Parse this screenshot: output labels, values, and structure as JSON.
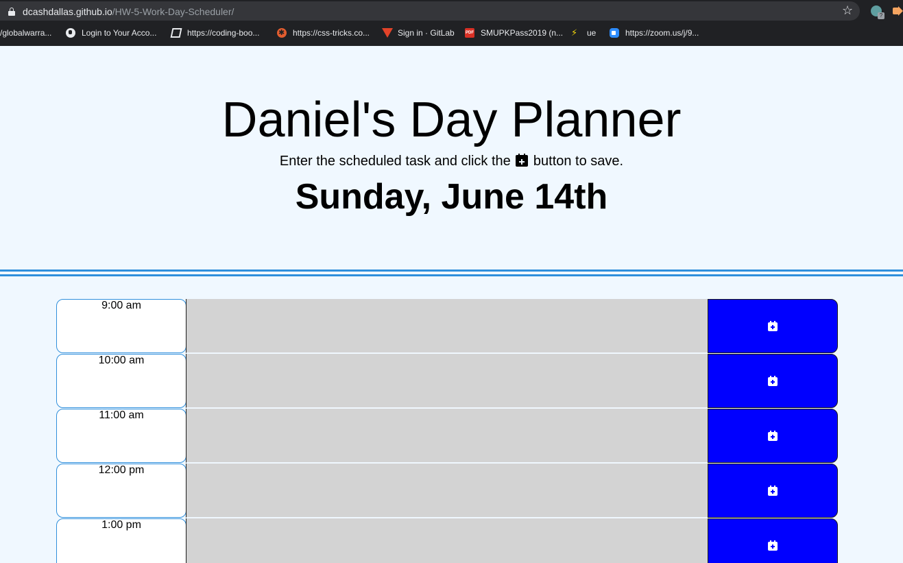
{
  "browser": {
    "url_host": "dcashdallas.github.io",
    "url_path": "/HW-5-Work-Day-Scheduler/",
    "bookmarks": [
      {
        "label": "/globalwarra...",
        "icon": "none"
      },
      {
        "label": "Login to Your Acco...",
        "icon": "globe-icon"
      },
      {
        "label": "https://coding-boo...",
        "icon": "book-icon"
      },
      {
        "label": "https://css-tricks.co...",
        "icon": "css-tricks-icon"
      },
      {
        "label": "Sign in · GitLab",
        "icon": "gitlab-icon"
      },
      {
        "label": "SMUPKPass2019 (n...",
        "icon": "pdf-icon"
      },
      {
        "label": "ue",
        "icon": "bolt-icon"
      },
      {
        "label": "https://zoom.us/j/9...",
        "icon": "zoom-icon"
      }
    ],
    "pdf_icon_text": "PDF",
    "ext_badge": "?"
  },
  "header": {
    "title": "Daniel's Day Planner",
    "lead_before": "Enter the scheduled task and click the",
    "lead_after": "button to save.",
    "current_day": "Sunday, June 14th"
  },
  "schedule": {
    "rows": [
      {
        "hour": "9:00 am",
        "task": ""
      },
      {
        "hour": "10:00 am",
        "task": ""
      },
      {
        "hour": "11:00 am",
        "task": ""
      },
      {
        "hour": "12:00 pm",
        "task": ""
      },
      {
        "hour": "1:00 pm",
        "task": ""
      }
    ]
  },
  "colors": {
    "page_background": "#f0f8ff",
    "divider": "#2f8fdc",
    "task_background": "#d3d3d3",
    "save_button": "#0000ff"
  }
}
